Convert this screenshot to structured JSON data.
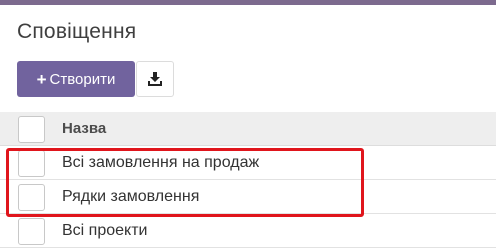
{
  "header": {
    "title": "Сповіщення"
  },
  "toolbar": {
    "create_label": "Створити",
    "create_icon": "plus-icon",
    "download_icon": "download-icon",
    "primary_color": "#71639e"
  },
  "table": {
    "columns": [
      "Назва"
    ],
    "rows": [
      {
        "name": "Всі замовлення на продаж"
      },
      {
        "name": "Рядки замовлення"
      },
      {
        "name": "Всі проекти"
      }
    ]
  },
  "highlight_color": "#e0151c"
}
